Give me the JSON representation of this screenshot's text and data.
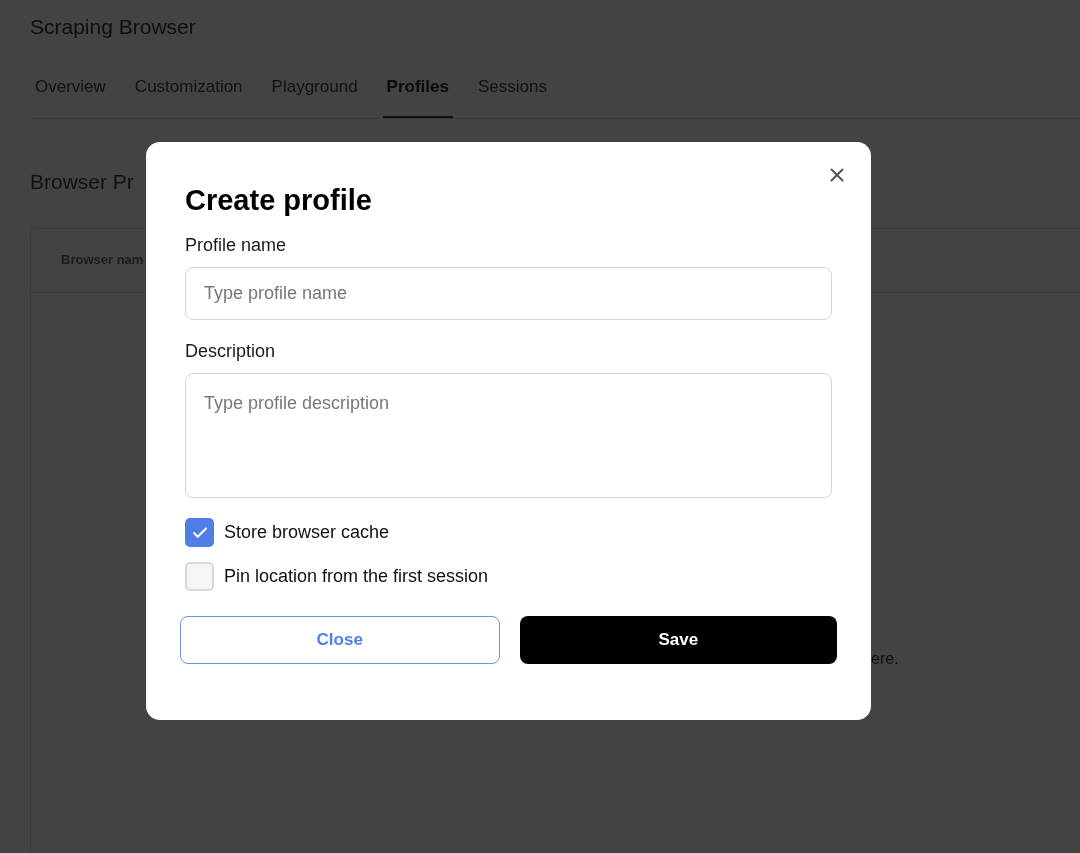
{
  "page": {
    "title": "Scraping Browser",
    "tabs": [
      {
        "label": "Overview",
        "selected": false
      },
      {
        "label": "Customization",
        "selected": false
      },
      {
        "label": "Playground",
        "selected": false
      },
      {
        "label": "Profiles",
        "selected": true
      },
      {
        "label": "Sessions",
        "selected": false
      }
    ],
    "section_title": "Browser Pr",
    "table": {
      "columns": [
        "Browser nam"
      ],
      "empty_message": "ere."
    }
  },
  "dialog": {
    "title": "Create profile",
    "fields": [
      {
        "kind": "input",
        "label": "Profile name",
        "placeholder": "Type profile name"
      },
      {
        "kind": "textarea",
        "label": "Description",
        "placeholder": "Type profile description"
      }
    ],
    "options": [
      {
        "label": "Store browser cache",
        "checked": true
      },
      {
        "label": "Pin location from the first session",
        "checked": false
      }
    ],
    "buttons": [
      {
        "kind": "secondary",
        "label": "Close"
      },
      {
        "kind": "primary",
        "label": "Save"
      }
    ]
  }
}
